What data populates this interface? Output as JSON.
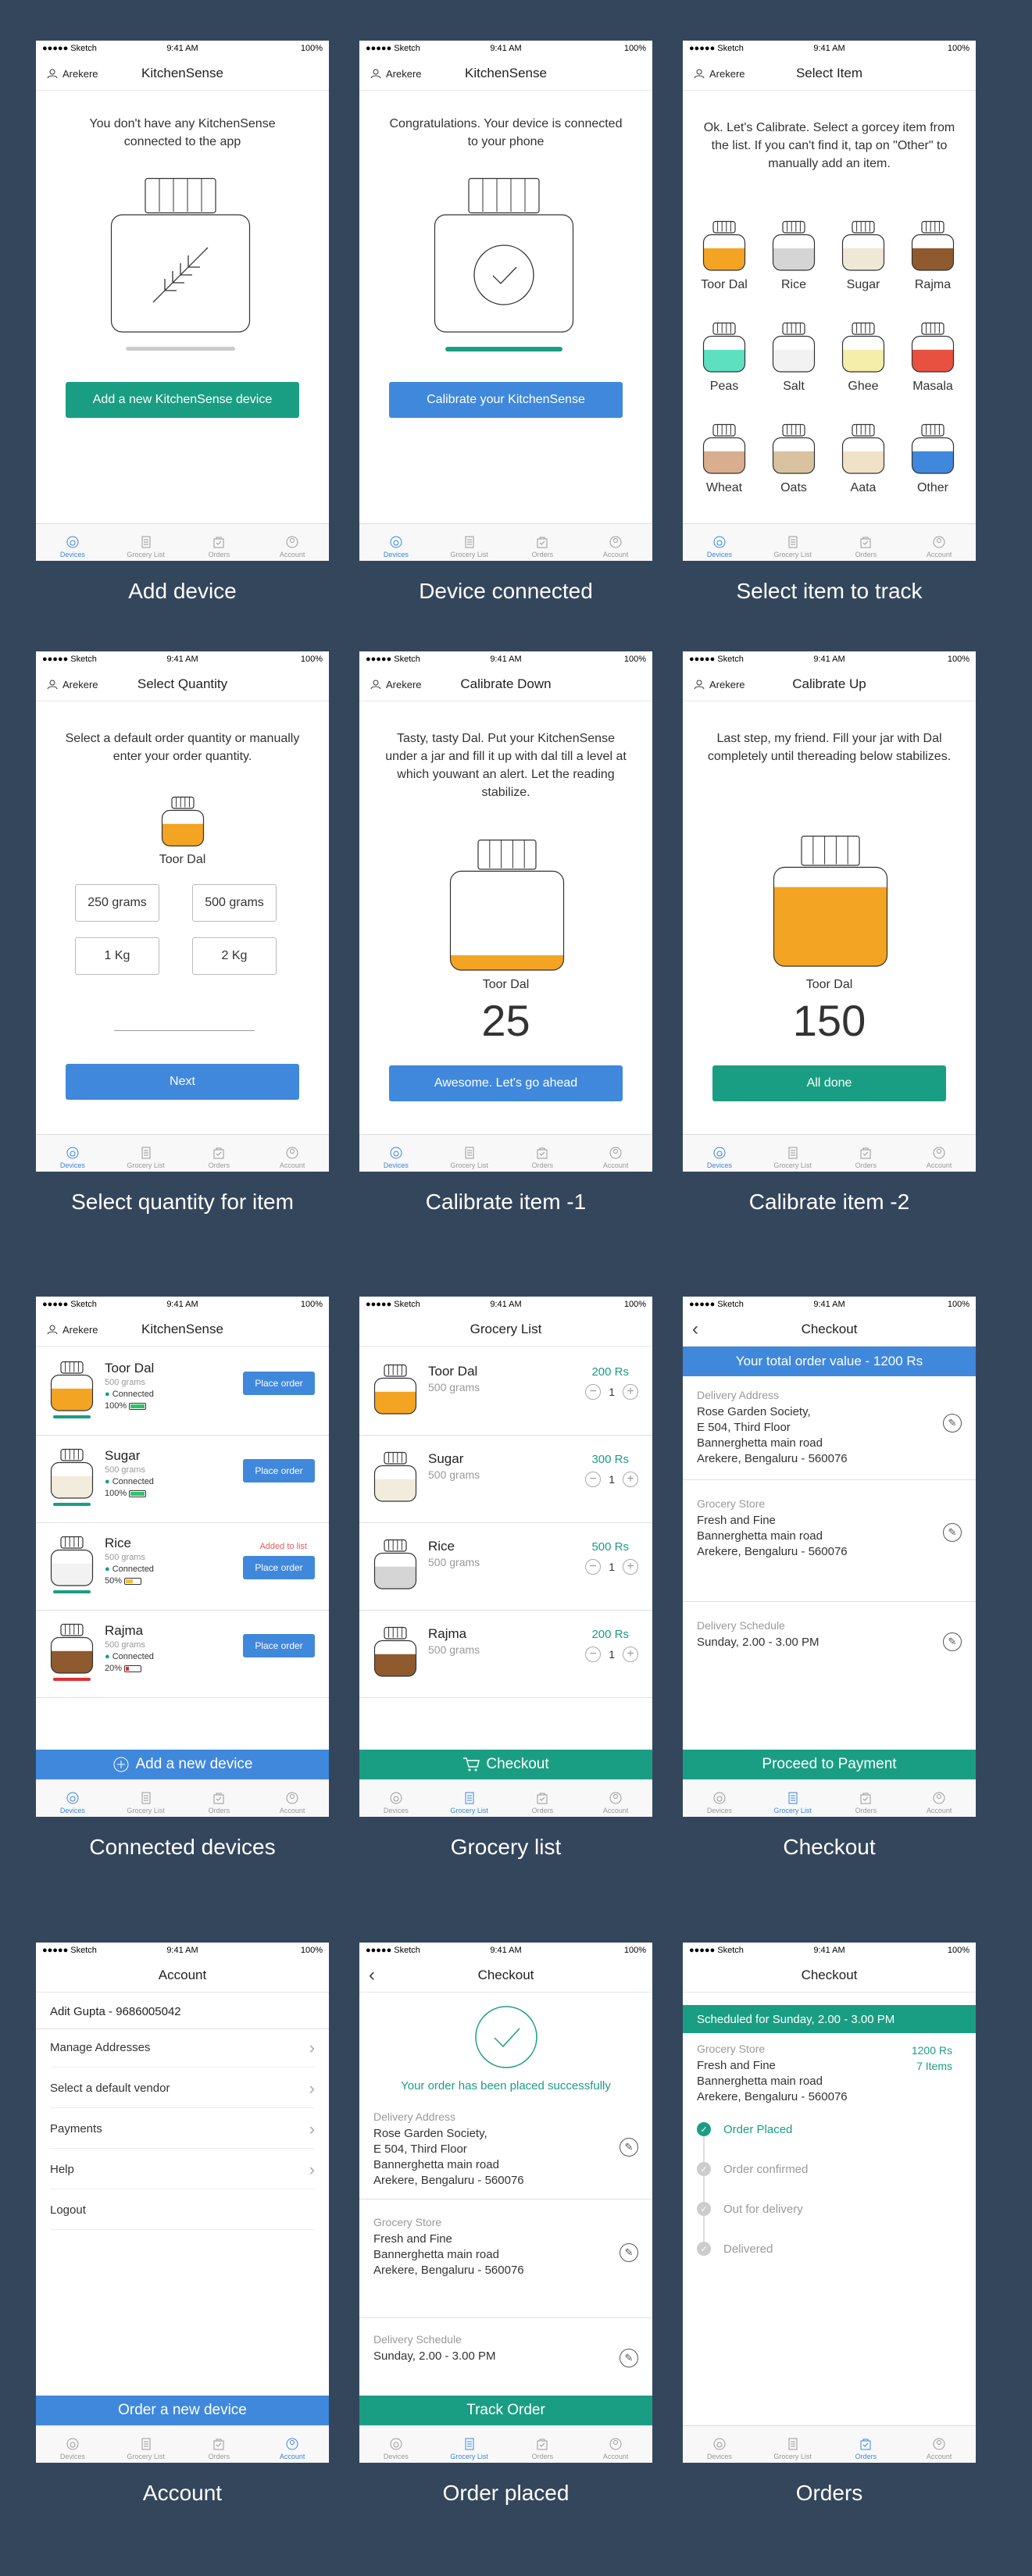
{
  "status_bar": {
    "carrier": "●●●●● Sketch",
    "time": "9:41 AM",
    "battery": "100%"
  },
  "tabs": [
    "Devices",
    "Grocery List",
    "Orders",
    "Account"
  ],
  "user": "Arekere",
  "s1": {
    "title": "KitchenSense",
    "message": "You don't have any KitchenSense connected to the app",
    "button": "Add a new KitchenSense device",
    "caption": "Add device"
  },
  "s2": {
    "title": "KitchenSense",
    "message": "Congratulations. Your device is connected to your phone",
    "button": "Calibrate your KitchenSense",
    "caption": "Device connected"
  },
  "s3": {
    "title": "Select Item",
    "message": "Ok. Let's Calibrate. Select a gorcey item from the list. If you can't find it, tap on \"Other\" to manually add an item.",
    "caption": "Select item to track",
    "items": [
      {
        "name": "Toor Dal",
        "color": "#f4a423"
      },
      {
        "name": "Rice",
        "color": "#d5d5d5"
      },
      {
        "name": "Sugar",
        "color": "#efe8d6"
      },
      {
        "name": "Rajma",
        "color": "#8e5a2e"
      },
      {
        "name": "Peas",
        "color": "#5de0c0"
      },
      {
        "name": "Salt",
        "color": "#f2f2f2"
      },
      {
        "name": "Ghee",
        "color": "#f5eeab"
      },
      {
        "name": "Masala",
        "color": "#e8513f"
      },
      {
        "name": "Wheat",
        "color": "#d8ae8e"
      },
      {
        "name": "Oats",
        "color": "#d8c2a0"
      },
      {
        "name": "Aata",
        "color": "#f0e2c6"
      },
      {
        "name": "Other",
        "color": "#3f88dc"
      }
    ]
  },
  "s4": {
    "title": "Select Quantity",
    "message": "Select a default order quantity or manually enter your order quantity.",
    "item": "Toor Dal",
    "quantities": [
      "250 grams",
      "500 grams",
      "1 Kg",
      "2 Kg"
    ],
    "button": "Next",
    "caption": "Select quantity for item"
  },
  "s5": {
    "title": "Calibrate Down",
    "message": "Tasty, tasty Dal. Put your KitchenSense under a jar and fill it up with dal till a level at which youwant an alert. Let the reading stabilize.",
    "item": "Toor Dal",
    "reading": "25",
    "fill": 0.15,
    "button": "Awesome. Let's go ahead",
    "caption": "Calibrate item -1"
  },
  "s6": {
    "title": "Calibrate Up",
    "message": "Last step, my friend. Fill your jar with Dal completely until thereading below stabilizes.",
    "item": "Toor Dal",
    "reading": "150",
    "fill": 0.8,
    "button": "All done",
    "caption": "Calibrate item -2"
  },
  "s7": {
    "title": "KitchenSense",
    "caption": "Connected devices",
    "bottom": "Add a new device",
    "devices": [
      {
        "name": "Toor Dal",
        "qty": "500 grams",
        "status": "Connected",
        "battery": "100%",
        "level": 1.0,
        "color": "#f4a423",
        "button": "Place order",
        "note": ""
      },
      {
        "name": "Sugar",
        "qty": "500 grams",
        "status": "Connected",
        "battery": "100%",
        "level": 1.0,
        "color": "#f2ecdc",
        "button": "Place order",
        "note": ""
      },
      {
        "name": "Rice",
        "qty": "500 grams",
        "status": "Connected",
        "battery": "50%",
        "level": 0.5,
        "color": "#f2f2f2",
        "button": "Place order",
        "note": "Added to list"
      },
      {
        "name": "Rajma",
        "qty": "500 grams",
        "status": "Connected",
        "battery": "20%",
        "level": 0.2,
        "color": "#8e5a2e",
        "button": "Place order",
        "note": ""
      }
    ]
  },
  "s8": {
    "title": "Grocery List",
    "caption": "Grocery list",
    "bottom": "Checkout",
    "items": [
      {
        "name": "Toor Dal",
        "qty": "500 grams",
        "price": "200 Rs",
        "count": "1",
        "color": "#f4a423"
      },
      {
        "name": "Sugar",
        "qty": "500 grams",
        "price": "300 Rs",
        "count": "1",
        "color": "#f2ecdc"
      },
      {
        "name": "Rice",
        "qty": "500 grams",
        "price": "500 Rs",
        "count": "1",
        "color": "#d5d5d5"
      },
      {
        "name": "Rajma",
        "qty": "500 grams",
        "price": "200 Rs",
        "count": "1",
        "color": "#8e5a2e"
      }
    ]
  },
  "s9": {
    "title": "Checkout",
    "banner": "Your total order value - 1200 Rs",
    "caption": "Checkout",
    "bottom": "Proceed to Payment",
    "addr_h": "Delivery Address",
    "addr": [
      "Rose Garden Society,",
      "E 504, Third Floor",
      "Bannerghetta main road",
      "Arekere, Bengaluru - 560076"
    ],
    "store_h": "Grocery Store",
    "store": [
      "Fresh and Fine",
      "Bannerghetta main road",
      "Arekere, Bengaluru - 560076"
    ],
    "sched_h": "Delivery Schedule",
    "sched": "Sunday, 2.00 - 3.00 PM"
  },
  "s10": {
    "title": "Account",
    "caption": "Account",
    "user": "Adit Gupta - 9686005042",
    "rows": [
      "Manage Addresses",
      "Select a default vendor",
      "Payments",
      "Help",
      "Logout"
    ],
    "bottom": "Order a new device"
  },
  "s11": {
    "title": "Checkout",
    "caption": "Order placed",
    "success": "Your order has been placed successfully",
    "bottom": "Track Order"
  },
  "s12": {
    "title": "Checkout",
    "caption": "Orders",
    "banner": "Scheduled for Sunday, 2.00 - 3.00 PM",
    "store_h": "Grocery Store",
    "store": [
      "Fresh and Fine",
      "Bannerghetta main road",
      "Arekere, Bengaluru - 560076"
    ],
    "total": "1200 Rs",
    "items": "7 Items",
    "steps": [
      "Order Placed",
      "Order confirmed",
      "Out for delivery",
      "Delivered"
    ]
  },
  "colors": {
    "teal": "#1a9e83",
    "blue": "#3f88dc",
    "background": "#34465c"
  }
}
